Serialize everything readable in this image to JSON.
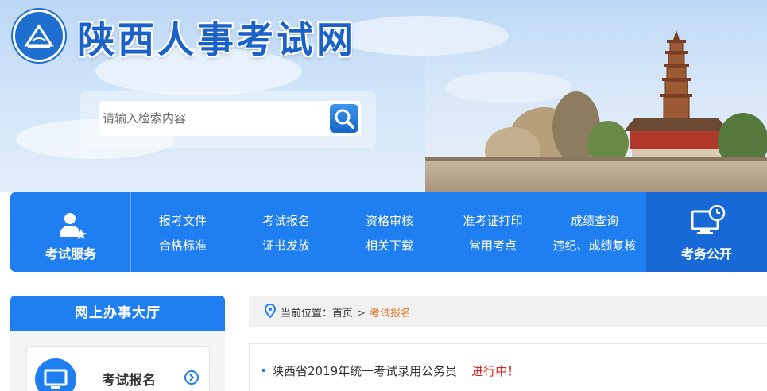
{
  "header": {
    "site_title": "陕西人事考试网",
    "search_placeholder": "请输入检索内容"
  },
  "nav": {
    "left_label": "考试服务",
    "right_label": "考务公开",
    "row1": [
      "报考文件",
      "考试报名",
      "资格审核",
      "准考证打印",
      "成绩查询"
    ],
    "row2": [
      "合格标准",
      "证书发放",
      "相关下载",
      "常用考点",
      "违纪、成绩复核"
    ]
  },
  "sidebar": {
    "title": "网上办事大厅",
    "card_label": "考试报名"
  },
  "breadcrumb": {
    "prefix": "当前位置：",
    "home": "首页",
    "separator": ">",
    "current": "考试报名"
  },
  "list": {
    "items": [
      {
        "title": "陕西省2019年统一考试录用公务员",
        "status": "进行中！"
      }
    ]
  },
  "colors": {
    "brand_blue": "#1f7ff0",
    "dark_blue": "#1769d6",
    "breadcrumb_current": "#e0701a",
    "status_red": "#e02020"
  }
}
